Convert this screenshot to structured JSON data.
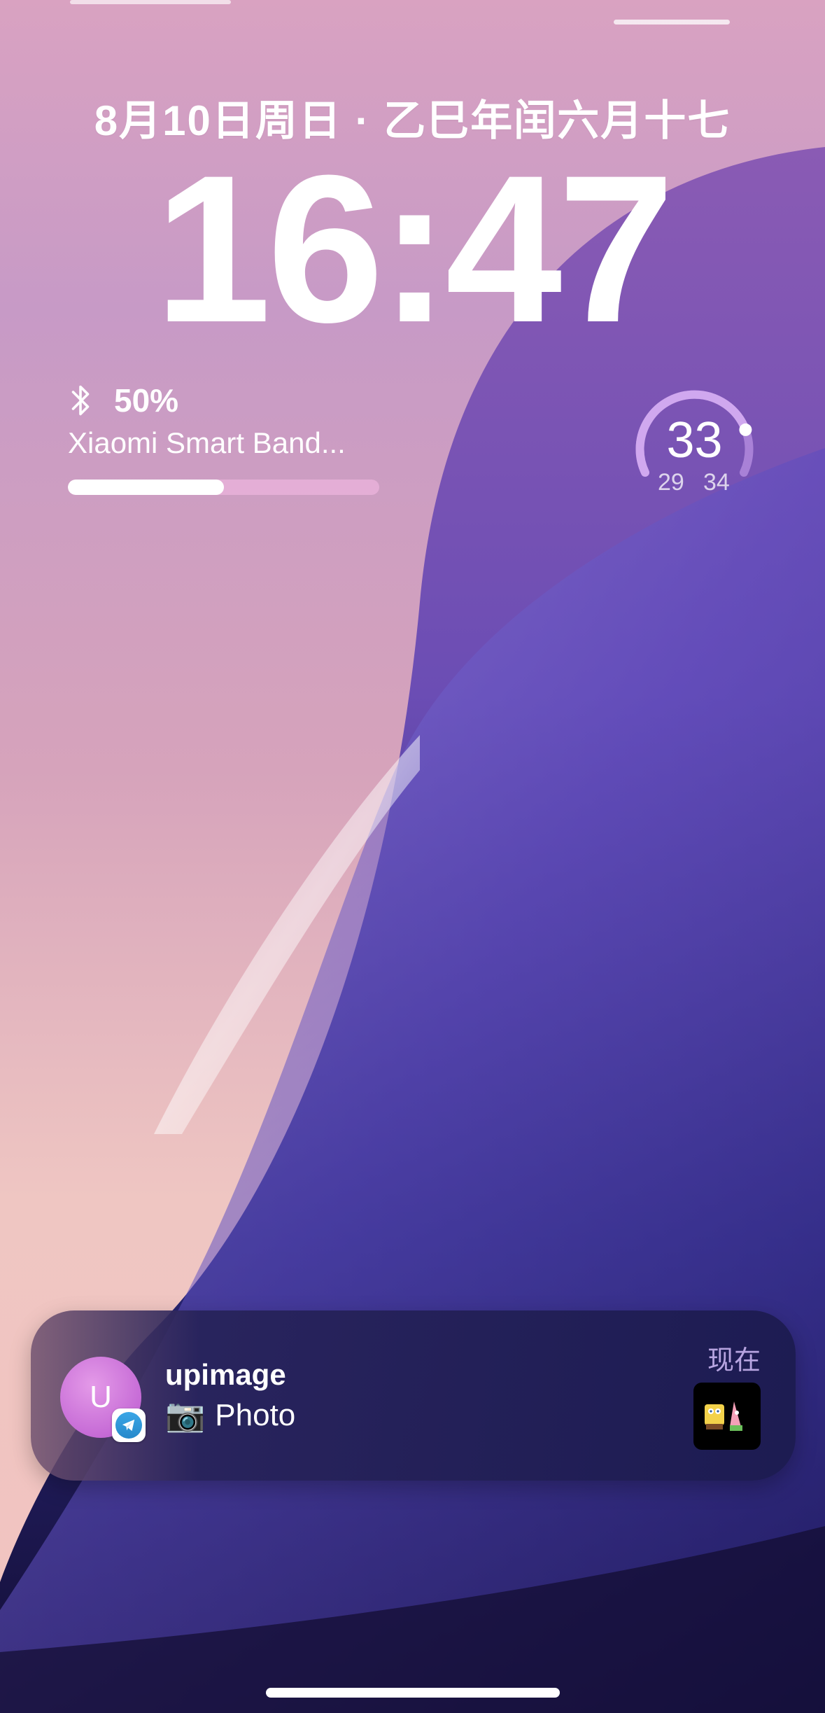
{
  "lockscreen": {
    "date": "8月10日周日 · 乙巳年闰六月十七",
    "time": "16:47"
  },
  "band_widget": {
    "icon": "bluetooth-icon",
    "battery": "50%",
    "battery_level": 0.5,
    "device_name": "Xiaomi Smart Band..."
  },
  "weather_widget": {
    "current": "33",
    "low": "29",
    "high": "34",
    "level": 0.8
  },
  "notification": {
    "avatar_letter": "U",
    "app_icon": "telegram-icon",
    "title": "upimage",
    "body_icon": "camera-icon",
    "body": "Photo",
    "time": "现在",
    "thumbnail": "sticker-thumbnail"
  },
  "colors": {
    "notification_bg": "#1c1b50",
    "avatar": "#c66bd6",
    "telegram": "#2689cb"
  }
}
